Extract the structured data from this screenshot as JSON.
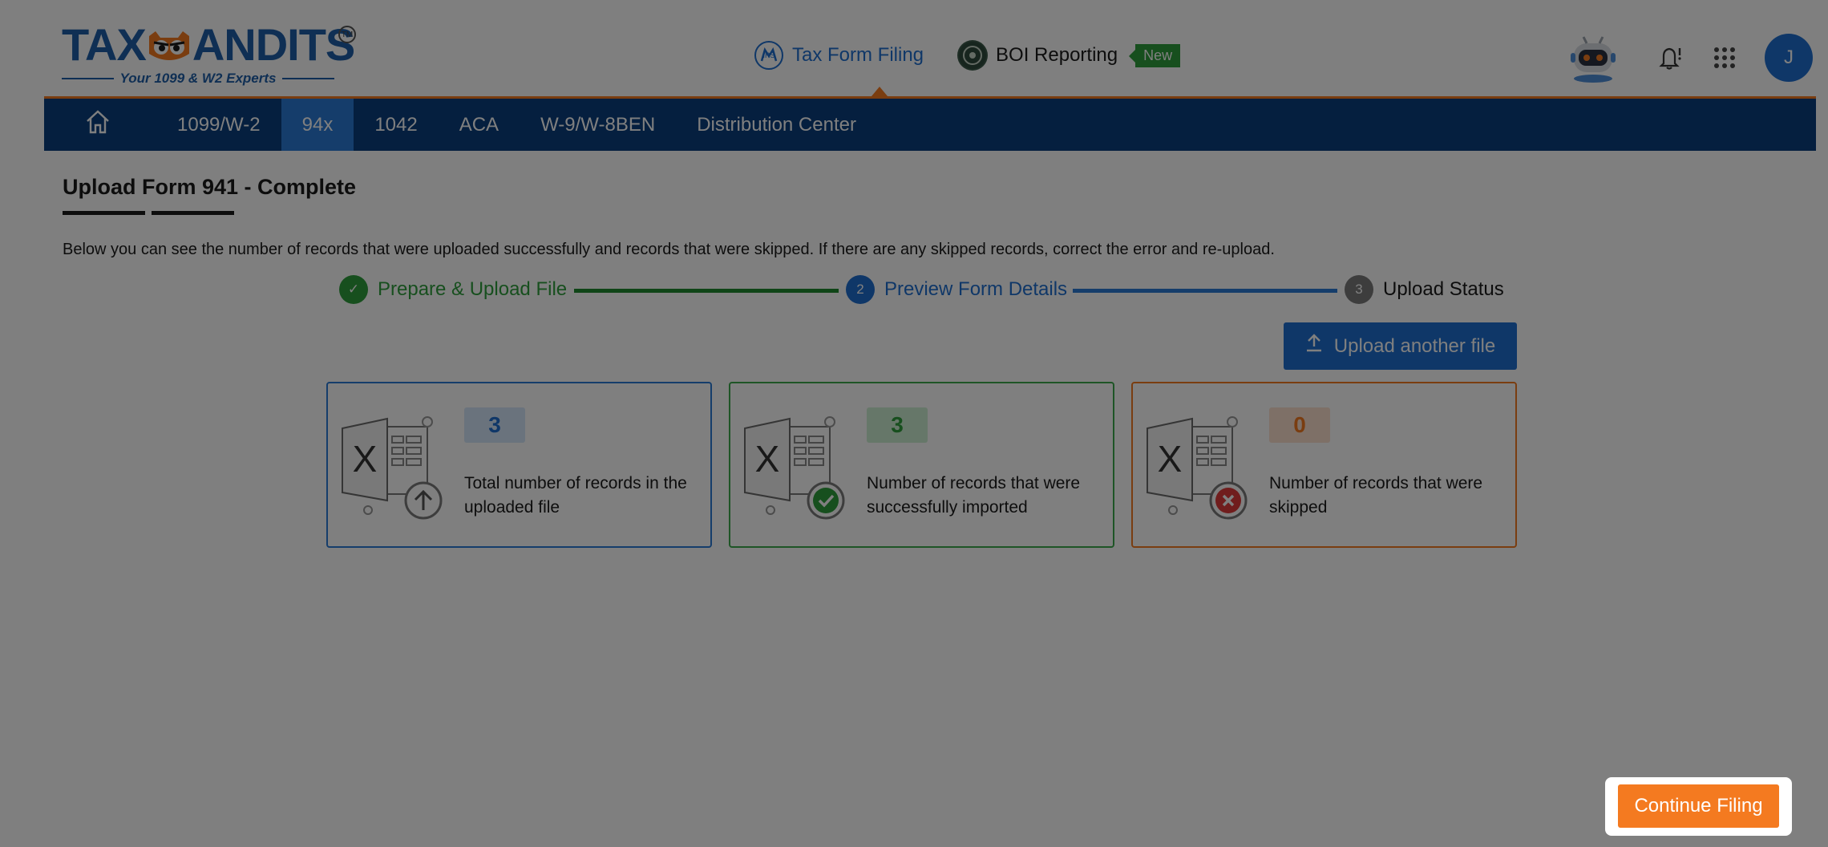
{
  "brand": {
    "logo_text_left": "TAX",
    "logo_text_right": "ANDITS",
    "trademark": "TM",
    "tagline": "Your 1099 & W2 Experts"
  },
  "header": {
    "links": [
      {
        "label": "Tax Form Filing",
        "icon": "irs-seal-icon",
        "active": true
      },
      {
        "label": "BOI Reporting",
        "icon": "fincen-seal-icon",
        "badge": "New"
      }
    ],
    "avatar_initial": "J"
  },
  "nav": {
    "items": [
      {
        "label": "1099/W-2"
      },
      {
        "label": "94x",
        "active": true
      },
      {
        "label": "1042"
      },
      {
        "label": "ACA"
      },
      {
        "label": "W-9/W-8BEN"
      },
      {
        "label": "Distribution Center"
      }
    ]
  },
  "page": {
    "title": "Upload Form 941 - Complete",
    "intro": "Below you can see the number of records that were uploaded successfully and records that were skipped. If there are any skipped records, correct the error and re-upload."
  },
  "stepper": {
    "steps": [
      {
        "marker": "✓",
        "label": "Prepare & Upload File",
        "status": "complete"
      },
      {
        "marker": "2",
        "label": "Preview Form Details",
        "status": "done"
      },
      {
        "marker": "3",
        "label": "Upload Status",
        "status": "current"
      }
    ]
  },
  "actions": {
    "upload_another": "Upload another file",
    "continue": "Continue Filing"
  },
  "cards": [
    {
      "count": "3",
      "description": "Total number of records in the uploaded file",
      "status": "total",
      "color": "#2b7bd6"
    },
    {
      "count": "3",
      "description": "Number of records that were successfully imported",
      "status": "success",
      "color": "#2e9e3c"
    },
    {
      "count": "0",
      "description": "Number of records that were skipped",
      "status": "skipped",
      "color": "#f47a20"
    }
  ],
  "colors": {
    "primary": "#1f6fd0",
    "nav": "#0b3e7e",
    "accent": "#f47a20",
    "success": "#2e9e3c",
    "error": "#e03a3a"
  }
}
